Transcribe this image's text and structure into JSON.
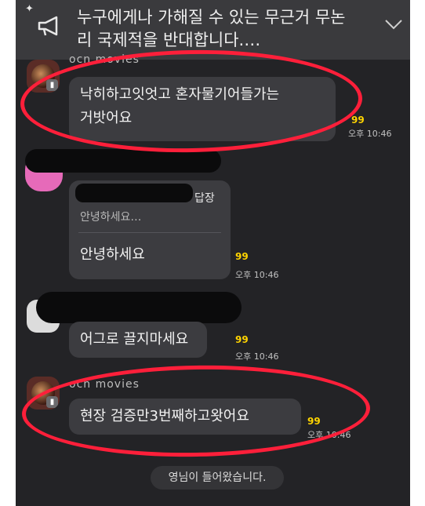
{
  "notice": {
    "pin_icon": "pin-icon",
    "line1": "누구에게나 가해질 수 있는 무근거 무논",
    "line2": "리 국제적을 반대합니다.…"
  },
  "sender_name": "ocn movies",
  "avatar_badge": "▮",
  "messages": [
    {
      "text_line1": "낙히하고잇엇고 혼자물기어들가는",
      "text_line2": "거밧어요",
      "unread": "99",
      "time": "오후 10:46"
    },
    {
      "reply_header": "답장",
      "reply_quote": "안녕하세요…",
      "text": "안녕하세요",
      "unread": "99",
      "time": "오후 10:46"
    },
    {
      "text": "어그로 끌지마세요",
      "unread": "99",
      "time": "오후 10:46"
    },
    {
      "text": "현장 검증만3번째하고왓어요",
      "unread": "99",
      "time": "오후 10:46"
    }
  ],
  "system_message": "영님이 들어왔습니다.",
  "colors": {
    "annotation": "#ff1f3a",
    "unread": "#ffd400",
    "background": "#232326",
    "bubble": "#3c3c40"
  }
}
